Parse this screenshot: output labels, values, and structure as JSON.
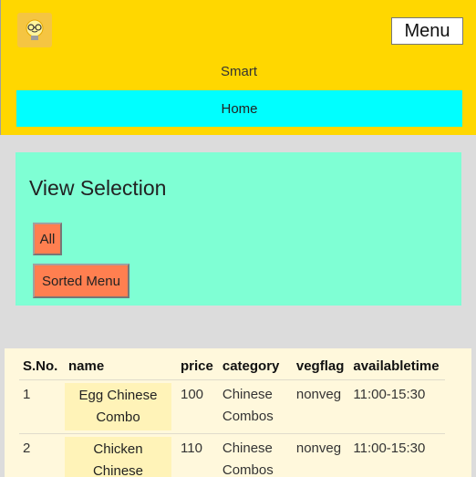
{
  "header": {
    "brand": "Smart",
    "menu_label": "Menu",
    "nav_home": "Home",
    "logo_icon": "smart-bulb-logo-icon"
  },
  "view_selection": {
    "title": "View Selection",
    "buttons": [
      "All",
      "Sorted Menu"
    ]
  },
  "table": {
    "columns": [
      "S.No.",
      "name",
      "price",
      "category",
      "vegflag",
      "availabletime"
    ],
    "rows": [
      {
        "sno": "1",
        "name": "Egg Chinese Combo",
        "price": "100",
        "category": "Chinese Combos",
        "vegflag": "nonveg",
        "availabletime": "11:00-15:30"
      },
      {
        "sno": "2",
        "name": "Chicken Chinese",
        "price": "110",
        "category": "Chinese Combos",
        "vegflag": "nonveg",
        "availabletime": "11:00-15:30"
      }
    ]
  },
  "colors": {
    "header_bg": "#ffd700",
    "nav_bg": "#00ffff",
    "panel_bg": "#7fffd4",
    "button_bg": "#ff7f50",
    "table_bg": "#fff8dc",
    "page_bg": "#dcdcdc"
  }
}
